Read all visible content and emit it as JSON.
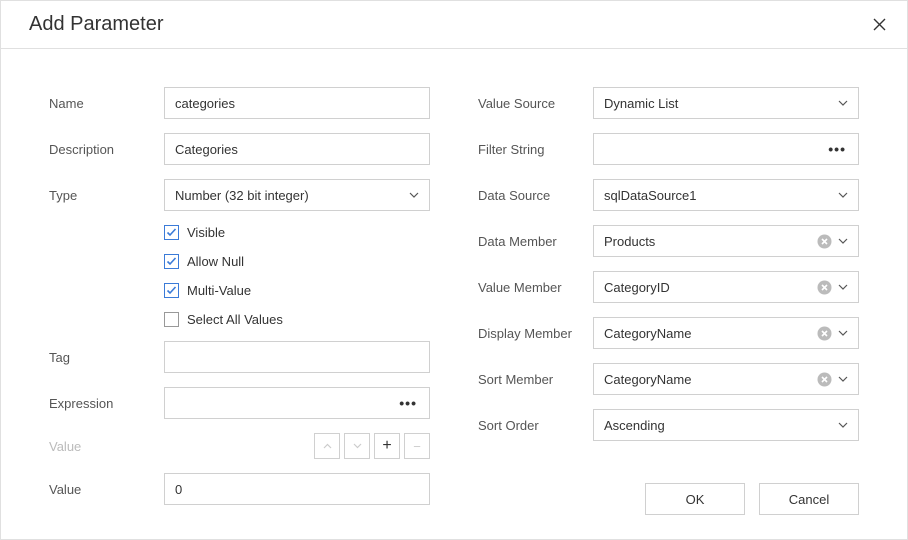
{
  "dialog": {
    "title": "Add Parameter"
  },
  "left": {
    "name_label": "Name",
    "name_value": "categories",
    "description_label": "Description",
    "description_value": "Categories",
    "type_label": "Type",
    "type_value": "Number (32 bit integer)",
    "visible_label": "Visible",
    "visible_checked": true,
    "allow_null_label": "Allow Null",
    "allow_null_checked": true,
    "multi_value_label": "Multi-Value",
    "multi_value_checked": true,
    "select_all_label": "Select All Values",
    "select_all_checked": false,
    "tag_label": "Tag",
    "tag_value": "",
    "expression_label": "Expression",
    "expression_value": "",
    "value_list_label": "Value",
    "value_label": "Value",
    "value_value": "0"
  },
  "right": {
    "value_source_label": "Value Source",
    "value_source_value": "Dynamic List",
    "filter_string_label": "Filter String",
    "filter_string_value": "",
    "data_source_label": "Data Source",
    "data_source_value": "sqlDataSource1",
    "data_member_label": "Data Member",
    "data_member_value": "Products",
    "value_member_label": "Value Member",
    "value_member_value": "CategoryID",
    "display_member_label": "Display Member",
    "display_member_value": "CategoryName",
    "sort_member_label": "Sort Member",
    "sort_member_value": "CategoryName",
    "sort_order_label": "Sort Order",
    "sort_order_value": "Ascending"
  },
  "buttons": {
    "ok": "OK",
    "cancel": "Cancel"
  }
}
